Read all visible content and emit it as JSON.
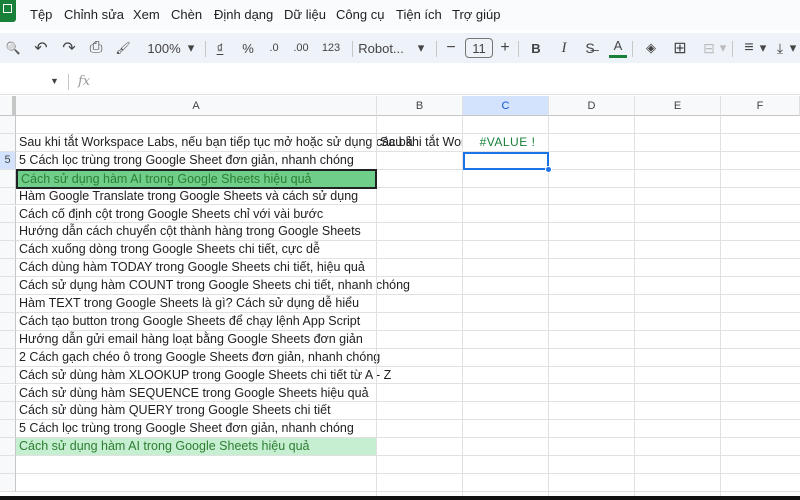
{
  "menu": [
    "Tệp",
    "Chỉnh sửa",
    "Xem",
    "Chèn",
    "Định dạng",
    "Dữ liệu",
    "Công cụ",
    "Tiện ích",
    "Trợ giúp"
  ],
  "toolbar": {
    "zoom": "100%",
    "currency": "₫",
    "percent": "%",
    "dec_decrease": ".0",
    "dec_increase": ".00",
    "format_123": "123",
    "font": "Robot...",
    "font_size": "11",
    "bold": "B",
    "italic": "I",
    "text_color": "A",
    "text_color_value": "#188038"
  },
  "formula_bar": {
    "fx": "fx",
    "value": ""
  },
  "columns": [
    "A",
    "B",
    "C",
    "D",
    "E",
    "F"
  ],
  "selected_column": "C",
  "rows": [
    {
      "num": "",
      "a": "",
      "b": "",
      "c": ""
    },
    {
      "num": "",
      "a": "Sau khi tắt Workspace Labs, nếu bạn tiếp tục mở hoặc sử dụng các bả",
      "b": "Sau khi tắt Work",
      "c": "#VALUE !"
    },
    {
      "num": "5",
      "a": "5 Cách lọc trùng trong Google Sheet đơn giản, nhanh chóng",
      "b": "",
      "c": ""
    },
    {
      "num": "",
      "a": "Cách sử dụng hàm AI trong Google Sheets hiệu quả",
      "b": "",
      "c": "",
      "style": "highlight"
    },
    {
      "num": "",
      "a": "Hàm Google Translate trong Google Sheets và cách sử dụng"
    },
    {
      "num": "",
      "a": "Cách cố định cột trong Google Sheets chỉ với vài bước"
    },
    {
      "num": "",
      "a": "Hướng dẫn cách chuyển cột thành hàng trong Google Sheets"
    },
    {
      "num": "",
      "a": "Cách xuống dòng trong Google Sheets chi tiết, cực dễ"
    },
    {
      "num": "",
      "a": "Cách dùng hàm TODAY trong Google Sheets chi tiết, hiệu quả"
    },
    {
      "num": "",
      "a": "Cách sử dụng hàm COUNT trong Google Sheets chi tiết, nhanh chóng"
    },
    {
      "num": "",
      "a": "Hàm TEXT trong Google Sheets là gì? Cách sử dụng dễ hiểu"
    },
    {
      "num": "",
      "a": "Cách tạo button trong Google Sheets để chạy lệnh App Script"
    },
    {
      "num": "",
      "a": "Hướng dẫn gửi email hàng loạt bằng Google Sheets đơn giản"
    },
    {
      "num": "",
      "a": "2 Cách gạch chéo ô trong Google Sheets đơn giản, nhanh chóng"
    },
    {
      "num": "",
      "a": "Cách sử dùng hàm XLOOKUP trong Google Sheets chi tiết từ A - Z"
    },
    {
      "num": "",
      "a": "Cách sử dùng hàm SEQUENCE trong Google Sheets hiệu quả"
    },
    {
      "num": "",
      "a": "Cách sử dùng hàm QUERY trong Google Sheets chi tiết"
    },
    {
      "num": "",
      "a": "5 Cách lọc trùng trong Google Sheet đơn giản, nhanh chóng"
    },
    {
      "num": "",
      "a": "Cách sử dụng hàm AI trong Google Sheets hiệu quả",
      "style": "light"
    },
    {
      "num": "",
      "a": ""
    },
    {
      "num": "",
      "a": ""
    }
  ],
  "colors": {
    "selection": "#1a73e8",
    "highlight_fill": "#6fcf8a",
    "light_fill": "#c6efd1",
    "green_text": "#2e7d32",
    "error_text": "#188038"
  }
}
